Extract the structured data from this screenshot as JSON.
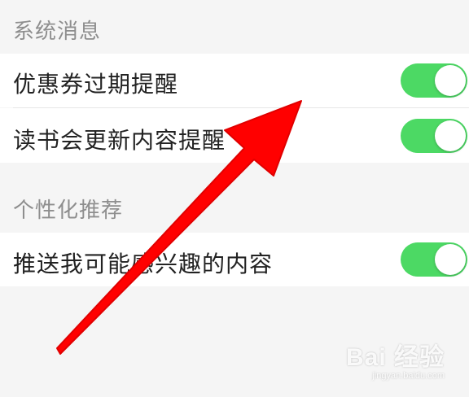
{
  "sections": [
    {
      "header": "系统消息",
      "items": [
        {
          "label": "优惠券过期提醒",
          "enabled": true
        },
        {
          "label": "读书会更新内容提醒",
          "enabled": true
        }
      ]
    },
    {
      "header": "个性化推荐",
      "items": [
        {
          "label": "推送我可能感兴趣的内容",
          "enabled": true
        }
      ]
    }
  ],
  "colors": {
    "toggle_on": "#4cd964",
    "arrow": "#ff0000",
    "background": "#f5f5f5"
  },
  "watermark": {
    "main": "Bai 经验",
    "sub": "jingyan.baidu.com"
  }
}
